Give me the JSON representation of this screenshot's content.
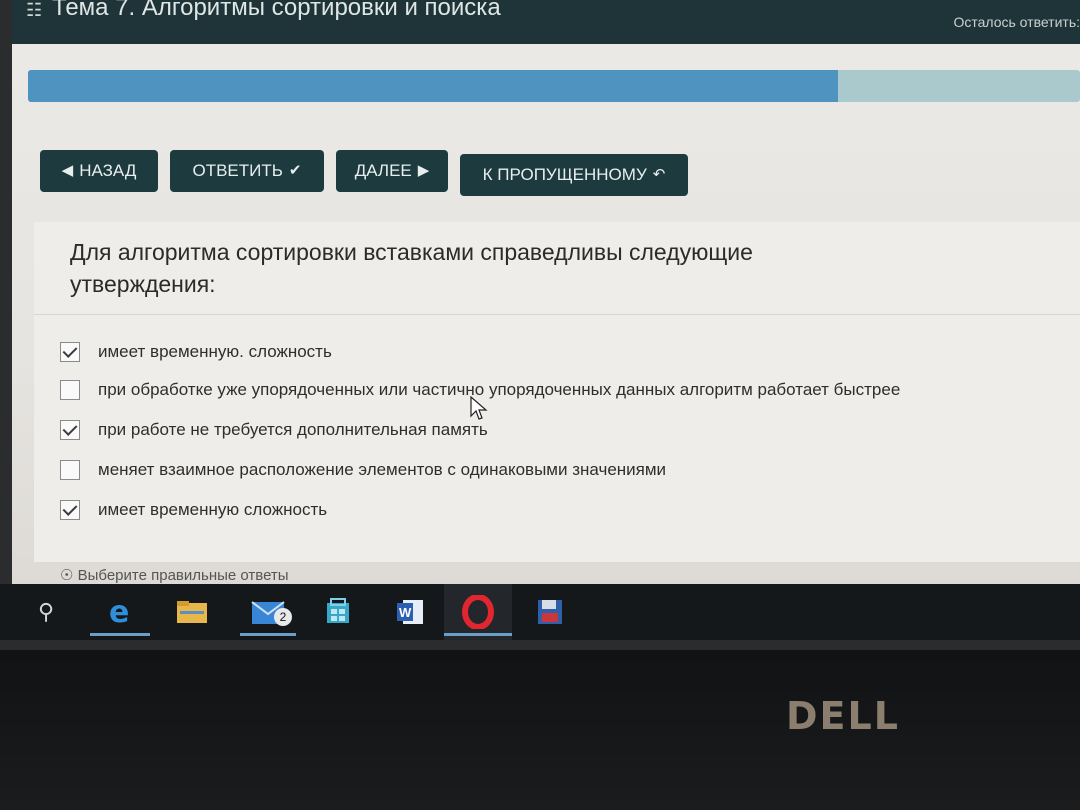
{
  "header": {
    "title": "Тема 7. Алгоритмы сортировки и поиска",
    "remaining_label": "Осталось ответить:",
    "icon": "book-icon"
  },
  "progress": {
    "value_percent": 77
  },
  "nav_buttons": {
    "back": "НАЗАД",
    "answer": "ОТВЕТИТЬ",
    "next": "ДАЛЕЕ",
    "skipped": "К ПРОПУЩЕННОМУ"
  },
  "question": {
    "text": "Для алгоритма сортировки вставками справедливы следующие утверждения:",
    "options": [
      {
        "label": "имеет временную. сложность",
        "checked": true
      },
      {
        "label": "при обработке уже упорядоченных или частично упорядоченных данных алгоритм работает быстрее",
        "checked": false
      },
      {
        "label": "при работе не требуется дополнительная память",
        "checked": true
      },
      {
        "label": "меняет взаимное расположение элементов с одинаковыми значениями",
        "checked": false
      },
      {
        "label": "имеет временную сложность",
        "checked": true
      }
    ],
    "hint": "Выберите правильные ответы"
  },
  "taskbar": {
    "items": [
      "search-icon",
      "edge-icon",
      "file-explorer-icon",
      "mail-icon",
      "store-icon",
      "word-icon",
      "opera-icon",
      "save-icon"
    ],
    "mail_badge": "2"
  },
  "bezel": {
    "brand": "DELL"
  },
  "colors": {
    "header_bg": "#1f3438",
    "button_bg": "#1d3a3f",
    "progress_fill": "#4f93c0",
    "progress_track": "#a9c9cc"
  }
}
